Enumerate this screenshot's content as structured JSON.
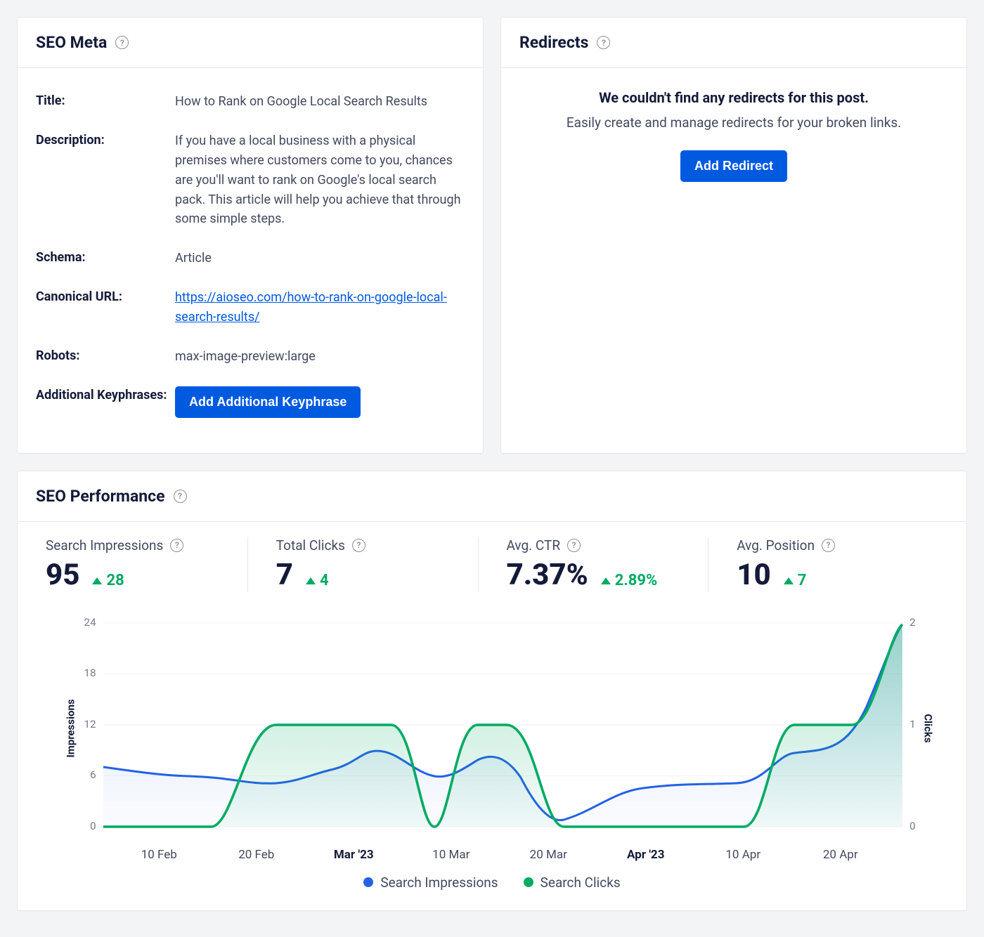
{
  "seo_meta": {
    "header": "SEO Meta",
    "rows": {
      "title_label": "Title:",
      "title_value": "How to Rank on Google Local Search Results",
      "desc_label": "Description:",
      "desc_value": "If you have a local business with a physical premises where customers come to you, chances are you'll want to rank on Google's local search pack. This article will help you achieve that through some simple steps.",
      "schema_label": "Schema:",
      "schema_value": "Article",
      "canonical_label": "Canonical URL:",
      "canonical_value": "https://aioseo.com/how-to-rank-on-google-local-search-results/",
      "robots_label": "Robots:",
      "robots_value": "max-image-preview:large",
      "keyphrase_label": "Additional Keyphrases:",
      "keyphrase_button": "Add Additional Keyphrase"
    }
  },
  "redirects": {
    "header": "Redirects",
    "empty_title": "We couldn't find any redirects for this post.",
    "empty_sub": "Easily create and manage redirects for your broken links.",
    "button": "Add Redirect"
  },
  "performance": {
    "header": "SEO Performance",
    "stats": {
      "impressions": {
        "label": "Search Impressions",
        "value": "95",
        "delta": "28"
      },
      "clicks": {
        "label": "Total Clicks",
        "value": "7",
        "delta": "4"
      },
      "ctr": {
        "label": "Avg. CTR",
        "value": "7.37%",
        "delta": "2.89%"
      },
      "position": {
        "label": "Avg. Position",
        "value": "10",
        "delta": "7"
      }
    },
    "axis_left": "Impressions",
    "axis_right": "Clicks",
    "legend": {
      "a": "Search Impressions",
      "b": "Search Clicks"
    },
    "x_ticks": [
      "10 Feb",
      "20 Feb",
      "Mar '23",
      "10 Mar",
      "20 Mar",
      "Apr '23",
      "10 Apr",
      "20 Apr"
    ],
    "y_left_ticks": [
      "0",
      "6",
      "12",
      "18",
      "24"
    ],
    "y_right_ticks": [
      "0",
      "1",
      "2"
    ]
  },
  "chart_data": {
    "type": "line",
    "title": "SEO Performance",
    "x_axis": {
      "categories": [
        "10 Feb",
        "20 Feb",
        "Mar '23",
        "10 Mar",
        "20 Mar",
        "Apr '23",
        "10 Apr",
        "20 Apr"
      ]
    },
    "y_left": {
      "label": "Impressions",
      "range": [
        0,
        24
      ],
      "ticks": [
        0,
        6,
        12,
        18,
        24
      ]
    },
    "y_right": {
      "label": "Clicks",
      "range": [
        0,
        2
      ],
      "ticks": [
        0,
        1,
        2
      ]
    },
    "series": [
      {
        "name": "Search Impressions",
        "axis": "left",
        "color": "#2462e5",
        "x": [
          "3 Feb",
          "10 Feb",
          "20 Feb",
          "25 Feb",
          "Mar '23",
          "5 Mar",
          "10 Mar",
          "15 Mar",
          "20 Mar",
          "25 Mar",
          "Apr '23",
          "5 Apr",
          "10 Apr",
          "15 Apr",
          "20 Apr",
          "28 Apr"
        ],
        "values": [
          7,
          6,
          5,
          7,
          9,
          6,
          8,
          5,
          1,
          4,
          5,
          5,
          5,
          9,
          9,
          24
        ]
      },
      {
        "name": "Search Clicks",
        "axis": "right",
        "color": "#00aa63",
        "x": [
          "3 Feb",
          "10 Feb",
          "15 Feb",
          "20 Feb",
          "25 Feb",
          "Mar '23",
          "5 Mar",
          "10 Mar",
          "15 Mar",
          "20 Mar",
          "Apr '23",
          "5 Apr",
          "10 Apr",
          "15 Apr",
          "20 Apr",
          "28 Apr"
        ],
        "values": [
          0,
          0,
          0,
          1,
          1,
          1,
          0,
          1,
          1,
          0,
          0,
          0,
          1,
          1,
          1,
          2
        ]
      }
    ]
  }
}
